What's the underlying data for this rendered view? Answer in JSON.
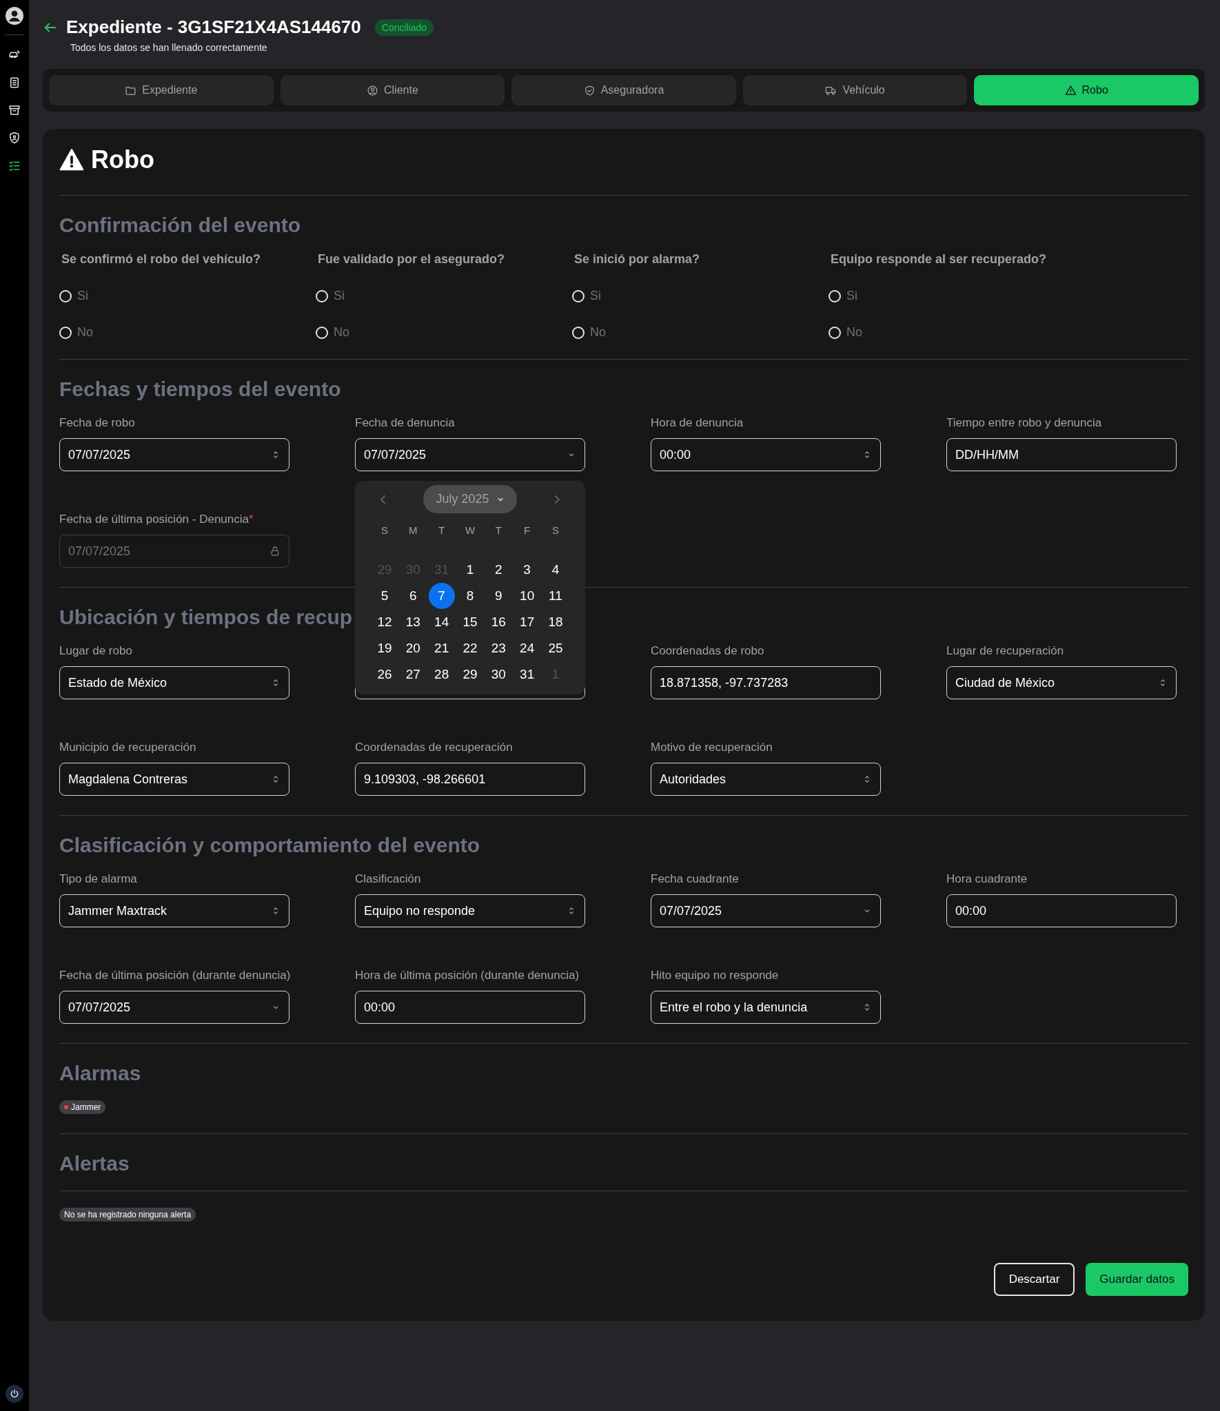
{
  "sidebar": {
    "items": [
      {
        "kind": "car",
        "selected": false
      },
      {
        "kind": "document",
        "selected": false
      },
      {
        "kind": "box",
        "selected": false
      },
      {
        "kind": "shield",
        "selected": false
      },
      {
        "kind": "checklist",
        "selected": true
      }
    ]
  },
  "header": {
    "title": "Expediente - 3G1SF21X4AS144670",
    "badge": "Conciliado",
    "subtitle": "Todos los datos se han llenado correctamente"
  },
  "tabs": [
    {
      "label": "Expediente",
      "kind": "folder",
      "selected": false
    },
    {
      "label": "Cliente",
      "kind": "user",
      "selected": false
    },
    {
      "label": "Aseguradora",
      "kind": "shield",
      "selected": false
    },
    {
      "label": "Vehículo",
      "kind": "truck",
      "selected": false
    },
    {
      "label": "Robo",
      "kind": "warning",
      "selected": true
    }
  ],
  "page_title": "Robo",
  "confirmation": {
    "title": "Confirmación del evento",
    "questions": [
      {
        "label": "Se confirmó el robo del vehículo?",
        "options": [
          {
            "label": "Si",
            "selected": false
          },
          {
            "label": "No",
            "selected": false
          }
        ]
      },
      {
        "label": "Fue validado por el asegurado?",
        "options": [
          {
            "label": "Si",
            "selected": false
          },
          {
            "label": "No",
            "selected": false
          }
        ]
      },
      {
        "label": "Se inició por alarma?",
        "options": [
          {
            "label": "Si",
            "selected": false
          },
          {
            "label": "No",
            "selected": false
          }
        ]
      },
      {
        "label": "Equipo responde al ser recuperado?",
        "options": [
          {
            "label": "Si",
            "selected": false
          },
          {
            "label": "No",
            "selected": false
          }
        ]
      }
    ]
  },
  "dates": {
    "title": "Fechas y tiempos del evento",
    "fields": [
      {
        "label": "Fecha de robo",
        "value": "07/07/2025",
        "kind": "select"
      },
      {
        "label": "Fecha de denuncia",
        "value": "07/07/2025",
        "kind": "date"
      },
      {
        "label": "Hora de denuncia",
        "value": "00:00",
        "kind": "select"
      },
      {
        "label": "Tiempo entre robo y denuncia",
        "value": "DD/HH/MM",
        "kind": "text"
      },
      {
        "label": "Fecha de última posición - Denuncia",
        "required_mark": "*",
        "value": "07/07/2025",
        "kind": "locked"
      }
    ]
  },
  "calendar": {
    "month": "July 2025",
    "weekdays": [
      "S",
      "M",
      "T",
      "W",
      "T",
      "F",
      "S"
    ],
    "days": [
      {
        "label": "29",
        "muted": true,
        "selected": false
      },
      {
        "label": "30",
        "muted": true,
        "selected": false
      },
      {
        "label": "31",
        "muted": true,
        "selected": false
      },
      {
        "label": "1",
        "muted": false,
        "selected": false
      },
      {
        "label": "2",
        "muted": false,
        "selected": false
      },
      {
        "label": "3",
        "muted": false,
        "selected": false
      },
      {
        "label": "4",
        "muted": false,
        "selected": false
      },
      {
        "label": "5",
        "muted": false,
        "selected": false
      },
      {
        "label": "6",
        "muted": false,
        "selected": false
      },
      {
        "label": "7",
        "muted": false,
        "selected": true
      },
      {
        "label": "8",
        "muted": false,
        "selected": false
      },
      {
        "label": "9",
        "muted": false,
        "selected": false
      },
      {
        "label": "10",
        "muted": false,
        "selected": false
      },
      {
        "label": "11",
        "muted": false,
        "selected": false
      },
      {
        "label": "12",
        "muted": false,
        "selected": false
      },
      {
        "label": "13",
        "muted": false,
        "selected": false
      },
      {
        "label": "14",
        "muted": false,
        "selected": false
      },
      {
        "label": "15",
        "muted": false,
        "selected": false
      },
      {
        "label": "16",
        "muted": false,
        "selected": false
      },
      {
        "label": "17",
        "muted": false,
        "selected": false
      },
      {
        "label": "18",
        "muted": false,
        "selected": false
      },
      {
        "label": "19",
        "muted": false,
        "selected": false
      },
      {
        "label": "20",
        "muted": false,
        "selected": false
      },
      {
        "label": "21",
        "muted": false,
        "selected": false
      },
      {
        "label": "22",
        "muted": false,
        "selected": false
      },
      {
        "label": "23",
        "muted": false,
        "selected": false
      },
      {
        "label": "24",
        "muted": false,
        "selected": false
      },
      {
        "label": "25",
        "muted": false,
        "selected": false
      },
      {
        "label": "26",
        "muted": false,
        "selected": false
      },
      {
        "label": "27",
        "muted": false,
        "selected": false
      },
      {
        "label": "28",
        "muted": false,
        "selected": false
      },
      {
        "label": "29",
        "muted": false,
        "selected": false
      },
      {
        "label": "30",
        "muted": false,
        "selected": false
      },
      {
        "label": "31",
        "muted": false,
        "selected": false
      },
      {
        "label": "1",
        "muted": true,
        "selected": false
      }
    ]
  },
  "location": {
    "title": "Ubicación y tiempos de recup",
    "fields": [
      {
        "label": "Lugar de robo",
        "value": "Estado de México",
        "kind": "select"
      },
      {
        "kind": "covered"
      },
      {
        "label": "Coordenadas de robo",
        "value": "18.871358, -97.737283",
        "kind": "text"
      },
      {
        "label": "Lugar de recuperación",
        "value": "Ciudad de México",
        "kind": "select"
      },
      {
        "label": "Municipio de recuperación",
        "value": "Magdalena Contreras",
        "kind": "select"
      },
      {
        "label": "Coordenadas de recuperación",
        "value": "9.109303, -98.266601",
        "kind": "text"
      },
      {
        "label": "Motivo de recuperación",
        "value": "Autoridades",
        "kind": "select"
      }
    ]
  },
  "classification": {
    "title": "Clasificación y comportamiento del evento",
    "fields": [
      {
        "label": "Tipo de alarma",
        "value": "Jammer Maxtrack",
        "kind": "select"
      },
      {
        "label": "Clasificación",
        "value": "Equipo no responde",
        "kind": "select"
      },
      {
        "label": "Fecha cuadrante",
        "value": "07/07/2025",
        "kind": "date"
      },
      {
        "label": "Hora cuadrante",
        "value": "00:00",
        "kind": "text"
      },
      {
        "label": "Fecha de última posición (durante denuncia)",
        "value": "07/07/2025",
        "kind": "date"
      },
      {
        "label": "Hora de última posición (durante denuncia)",
        "value": "00:00",
        "kind": "text"
      },
      {
        "label": "Hito equipo no responde",
        "value": "Entre el robo y la denuncia",
        "kind": "select"
      }
    ]
  },
  "alarms": {
    "title": "Alarmas",
    "items": [
      {
        "label": "Jammer",
        "color": "#ef4444"
      }
    ]
  },
  "alerts": {
    "title": "Alertas",
    "empty": "No se ha registrado ninguna alerta"
  },
  "buttons": [
    {
      "label": "Descartar",
      "kind": "secondary"
    },
    {
      "label": "Guardar datos",
      "kind": "primary"
    }
  ]
}
